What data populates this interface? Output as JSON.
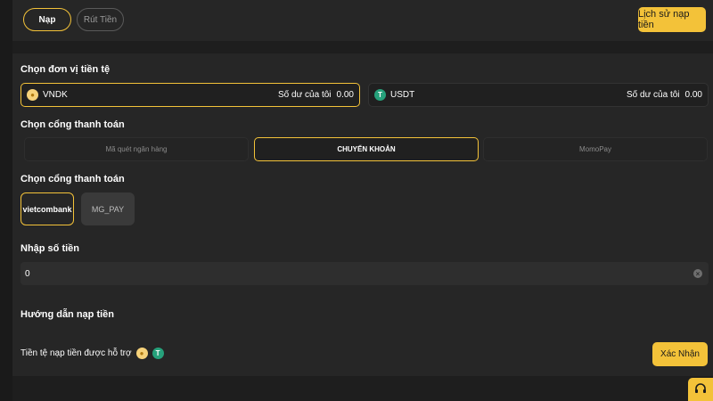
{
  "tabs": {
    "deposit": "Nạp",
    "withdraw": "Rút Tiền"
  },
  "history_button": "Lịch sử nạp tiền",
  "currency_section": {
    "label": "Chọn đơn vị tiền tệ",
    "currencies": [
      {
        "name": "VNDK",
        "balance_label": "Số dư của tôi",
        "balance": "0.00",
        "icon": "vndk-coin-icon",
        "selected": true
      },
      {
        "name": "USDT",
        "balance_label": "Số dư của tôi",
        "balance": "0.00",
        "icon": "usdt-coin-icon",
        "selected": false
      }
    ]
  },
  "gateway_section": {
    "label": "Chọn cổng thanh toán",
    "options": [
      "Mã quét ngân hàng",
      "CHUYỂN KHOẢN",
      "MomoPay"
    ],
    "selected": "CHUYỂN KHOẢN"
  },
  "bank_section": {
    "label": "Chọn cổng thanh toán",
    "banks": [
      "vietcombank",
      "MG_PAY"
    ],
    "selected": "vietcombank"
  },
  "amount_section": {
    "label": "Nhập số tiền",
    "value": "0"
  },
  "guide_label": "Hướng dẫn nạp tiền",
  "supported_label": "Tiền tệ nạp tiền được hỗ trợ",
  "confirm_button": "Xác Nhận",
  "colors": {
    "accent": "#f3c239",
    "background": "#1e1e1e",
    "panel": "#262626",
    "usdt": "#26a17b"
  }
}
